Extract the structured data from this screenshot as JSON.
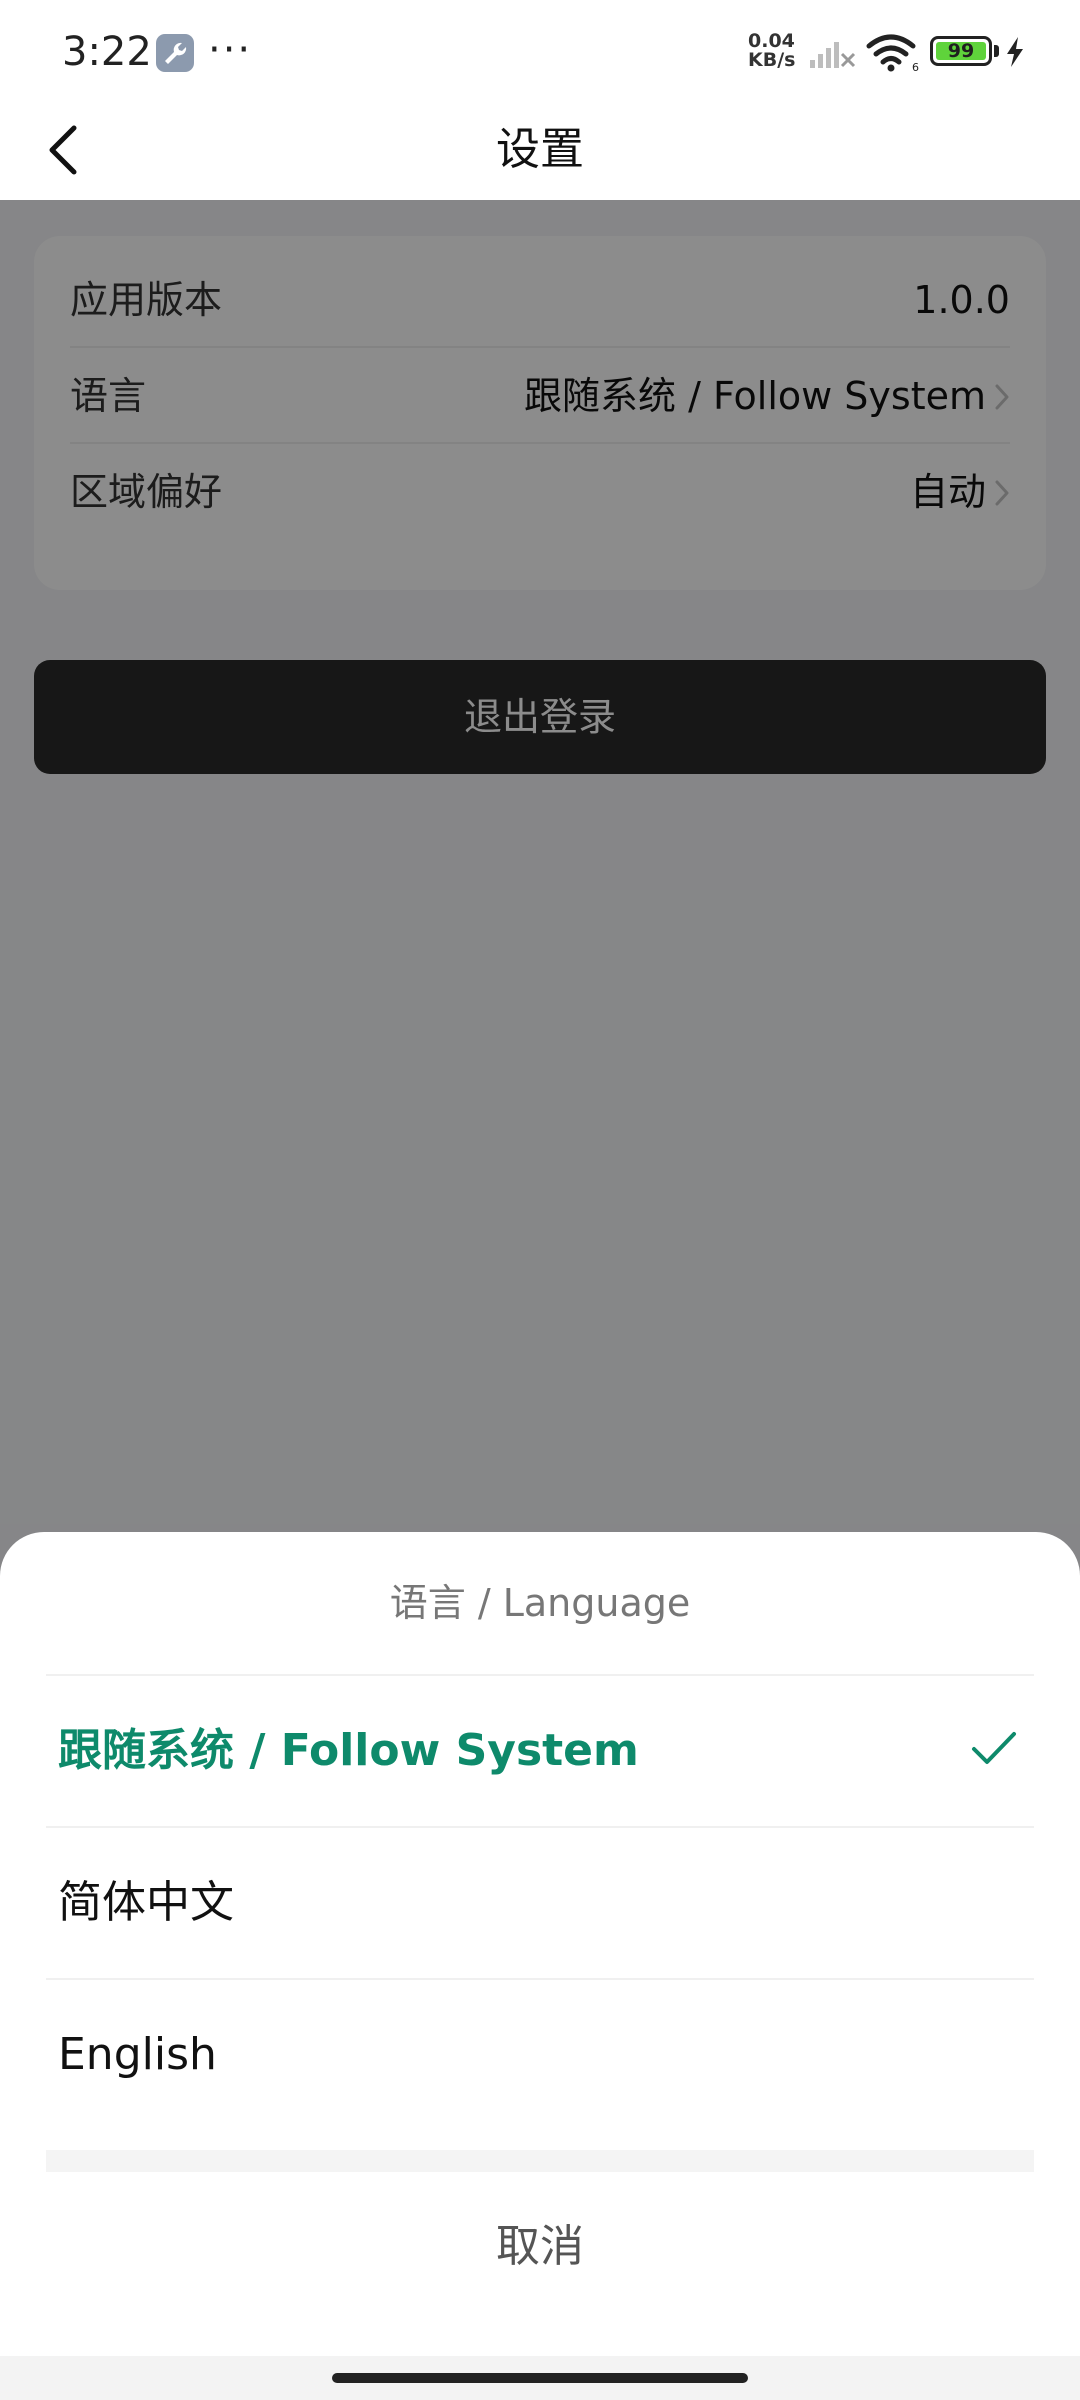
{
  "status_bar": {
    "time": "3:22",
    "app_icon": "wrench-icon",
    "more": "···",
    "net_speed_value": "0.04",
    "net_speed_unit": "KB/s",
    "battery_level": "99",
    "icons": [
      "signal-icon",
      "wifi-icon",
      "battery-icon",
      "charging-icon"
    ]
  },
  "header": {
    "title": "设置",
    "back_icon": "chevron-left-icon"
  },
  "settings": {
    "rows": [
      {
        "label": "应用版本",
        "value": "1.0.0"
      },
      {
        "label": "语言",
        "value": "跟随系统 / Follow System"
      },
      {
        "label": "区域偏好",
        "value": "自动"
      }
    ],
    "logout_label": "退出登录"
  },
  "language_sheet": {
    "title": "语言 / Language",
    "options": [
      {
        "label": "跟随系统 / Follow System",
        "selected": true
      },
      {
        "label": "简体中文",
        "selected": false
      },
      {
        "label": "English",
        "selected": false
      }
    ],
    "cancel_label": "取消"
  },
  "colors": {
    "accent": "#0e8a6b",
    "logout_button": "#2a2a2a",
    "battery_fill": "#5fd33b"
  }
}
